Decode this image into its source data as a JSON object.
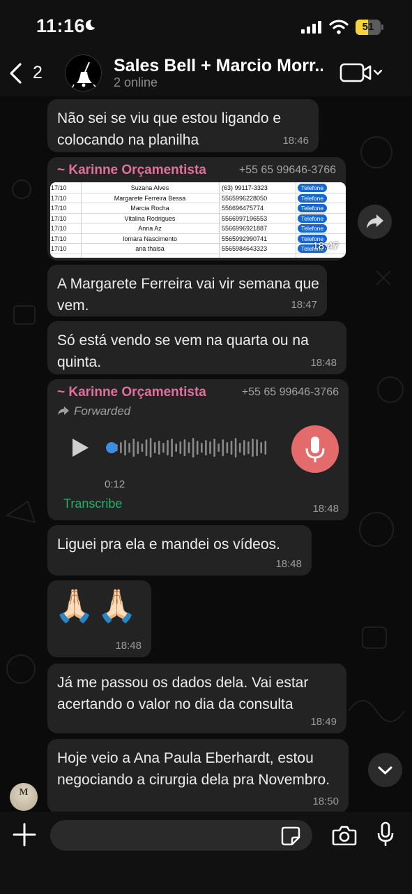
{
  "status_bar": {
    "time": "11:16",
    "battery": "51",
    "battery_level": 0.51
  },
  "header": {
    "back_count": "2",
    "group_name": "Sales Bell + Marcio Morr...",
    "group_status": "2 online"
  },
  "messages": [
    {
      "text": "Não sei se viu que estou ligando e colocando na planilha",
      "time": "18:46"
    },
    {
      "sender": "~ Karinne Orçamentista",
      "phone": "+55 65 99646-3766",
      "time": "18:47",
      "sheet_rows": [
        {
          "date": "17/10",
          "name": "Suzana Alves",
          "phone": "(63) 99117-3323",
          "tag": "Telefone"
        },
        {
          "date": "17/10",
          "name": "Margarete Ferreira Bessa",
          "phone": "5565996228050",
          "tag": "Telefone"
        },
        {
          "date": "17/10",
          "name": "Marcia Rocha",
          "phone": "556696475774",
          "tag": "Telefone"
        },
        {
          "date": "17/10",
          "name": "Vitalina Rodrigues",
          "phone": "5566997196553",
          "tag": "Telefone"
        },
        {
          "date": "17/10",
          "name": "Anna Az",
          "phone": "5566996921887",
          "tag": "Telefone"
        },
        {
          "date": "17/10",
          "name": "Iomara Nascimento",
          "phone": "5565992990741",
          "tag": "Telefone"
        },
        {
          "date": "17/10",
          "name": "ana thaisa",
          "phone": "5565984643323",
          "tag": "Telefone"
        }
      ]
    },
    {
      "text": "A Margarete Ferreira vai vir semana que vem.",
      "time": "18:47"
    },
    {
      "text": "Só está vendo se vem na quarta ou na quinta.",
      "time": "18:48"
    },
    {
      "sender": "~ Karinne Orçamentista",
      "phone": "+55 65 99646-3766",
      "forwarded": "Forwarded",
      "duration": "0:12",
      "transcribe": "Transcribe",
      "time": "18:48",
      "audio_progress": 0.0
    },
    {
      "text": "Liguei pra ela e mandei os vídeos.",
      "time": "18:48"
    },
    {
      "emoji": "🙏🏻🙏🏻",
      "time": "18:48"
    },
    {
      "text": "Já me passou os dados dela. Vai estar acertando o valor no dia da consulta",
      "time": "18:49"
    },
    {
      "text": "Hoje veio a Ana Paula Eberhardt, estou negociando a cirurgia dela pra Novembro.",
      "time": "18:50"
    }
  ],
  "composer": {
    "placeholder": ""
  },
  "colors": {
    "bubble": "#232323",
    "sender": "#e0719a",
    "transcribe": "#21b26a",
    "mic_button": "#e36b6b",
    "audio_dot": "#3a8ee6"
  },
  "icons": [
    "moon-icon",
    "signal-icon",
    "wifi-icon",
    "battery-icon",
    "back-chevron-icon",
    "video-call-icon",
    "forward-icon",
    "play-icon",
    "microphone-icon",
    "chevron-down-icon",
    "plus-icon",
    "sticker-icon",
    "camera-icon"
  ]
}
